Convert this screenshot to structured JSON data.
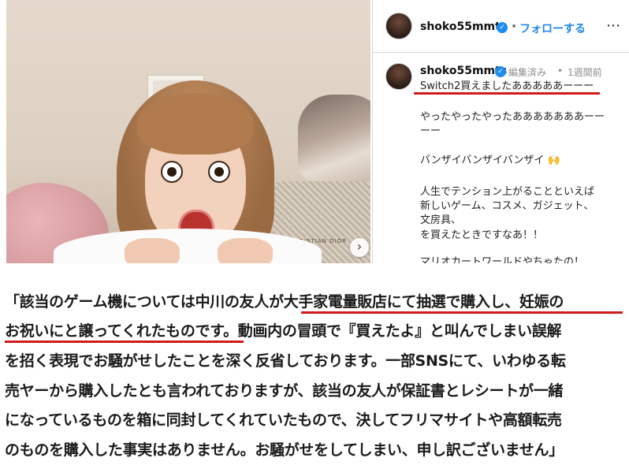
{
  "post": {
    "header": {
      "username": "shoko55mmts",
      "separator": "•",
      "follow_label": "フォローする",
      "more_label": "⋯"
    },
    "caption": {
      "username": "shoko55mmts",
      "edited": "編集済み",
      "separator": "•",
      "time_ago": "1週間前",
      "lines": [
        "Switch2買えましたあああああーーー",
        "やったやったやったあああああああーー",
        "ーー",
        "バンザイバンザイバンザイ 🙌",
        "人生でテンション上がることといえば",
        "新しいゲーム、コスメ、ガジェット、",
        "文房具、",
        "を買えたときですなあ！！",
        "マリオカートワールドやちゃたの！"
      ]
    },
    "photo": {
      "bag_text": "CHRISTIAN DIOR",
      "next_icon": "›"
    }
  },
  "statement": {
    "lines": [
      "「該当のゲーム機については中川の友人が大手家電量販店にて抽選で購入し、妊娠の",
      "お祝いにと譲ってくれたものです。動画内の冒頭で『買えたよ』と叫んでしまい誤解",
      "を招く表現でお騒がせしたことを深く反省しております。一部SNSにて、いわゆる転",
      "売ヤーから購入したとも言われておりますが、該当の友人が保証書とレシートが一緒",
      "になっているものを箱に同封してくれていたもので、決してフリマサイトや高額転売",
      "のものを購入した事実はありません。お騒がせをしてしまい、申し訳ございません」"
    ]
  },
  "colors": {
    "accent_underline": "#d11b1b",
    "follow_blue": "#1f86e6",
    "verified_blue": "#1e8cf0"
  },
  "icons": {
    "verified": "verified-badge-icon",
    "next": "chevron-right-icon",
    "more": "more-options-icon"
  }
}
